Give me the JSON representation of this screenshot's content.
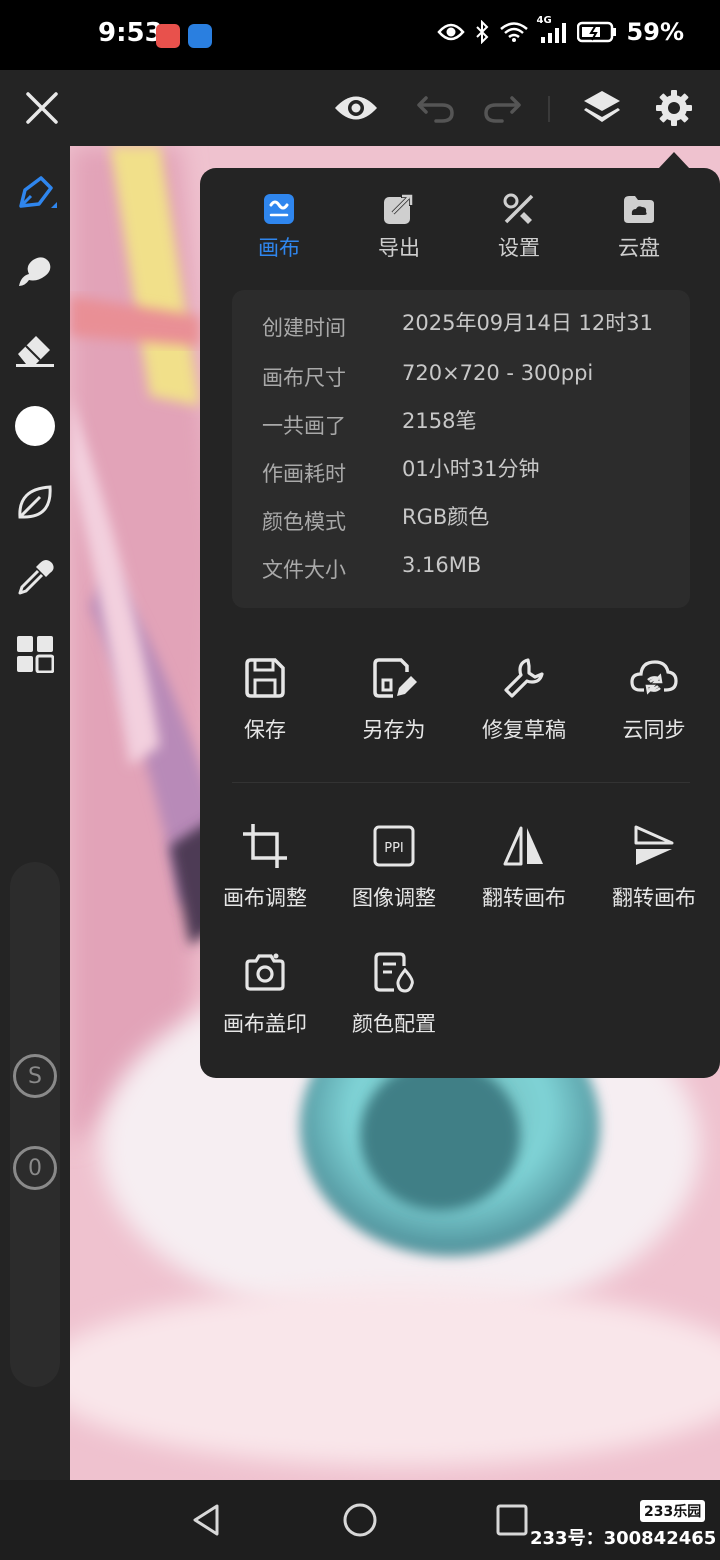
{
  "status_bar": {
    "time": "9:53",
    "network": "4G",
    "battery_percent": "59%",
    "icons": [
      "eye-icon",
      "bluetooth-icon",
      "wifi-icon",
      "signal-icon",
      "battery-icon"
    ]
  },
  "top_toolbar": {
    "icons": [
      "close-icon",
      "eye-icon",
      "undo-icon",
      "redo-icon",
      "layers-icon",
      "gear-icon"
    ]
  },
  "left_toolbar": {
    "icons": [
      "pen-brush-icon",
      "smudge-brush-icon",
      "eraser-icon",
      "color-swatch-icon",
      "leaf-icon",
      "eyedropper-icon",
      "grid-icon"
    ],
    "current_color": "#ffffff",
    "size_label": "S",
    "opacity_label": "0"
  },
  "panel": {
    "tabs": [
      {
        "label": "画布",
        "icon": "canvas-icon",
        "active": true
      },
      {
        "label": "导出",
        "icon": "export-icon",
        "active": false
      },
      {
        "label": "设置",
        "icon": "tools-icon",
        "active": false
      },
      {
        "label": "云盘",
        "icon": "cloud-drive-icon",
        "active": false
      }
    ],
    "info": [
      {
        "key": "创建时间",
        "value": "2025年09月14日 12时31分"
      },
      {
        "key": "画布尺寸",
        "value": "720×720 - 300ppi"
      },
      {
        "key": "一共画了",
        "value": "2158笔"
      },
      {
        "key": "作画耗时",
        "value": "01小时31分钟"
      },
      {
        "key": "颜色模式",
        "value": "RGB颜色"
      },
      {
        "key": "文件大小",
        "value": "3.16MB"
      }
    ],
    "actions_row1": [
      {
        "label": "保存",
        "icon": "save-icon"
      },
      {
        "label": "另存为",
        "icon": "save-as-icon"
      },
      {
        "label": "修复草稿",
        "icon": "wrench-icon"
      },
      {
        "label": "云同步",
        "icon": "cloud-sync-icon"
      }
    ],
    "actions_row2": [
      {
        "label": "画布调整",
        "icon": "crop-icon"
      },
      {
        "label": "图像调整",
        "icon": "ppi-icon",
        "icon_text": "PPI"
      },
      {
        "label": "翻转画布",
        "icon": "flip-horizontal-icon"
      },
      {
        "label": "翻转画布",
        "icon": "flip-vertical-icon"
      }
    ],
    "actions_row3": [
      {
        "label": "画布盖印",
        "icon": "camera-icon"
      },
      {
        "label": "颜色配置",
        "icon": "color-config-icon"
      }
    ],
    "accent_color": "#2f86ee"
  },
  "watermark": {
    "logo": "233乐园",
    "id_text": "233号：300842465"
  },
  "nav_bar": {
    "icons": [
      "back-icon",
      "home-icon",
      "recents-icon"
    ]
  }
}
